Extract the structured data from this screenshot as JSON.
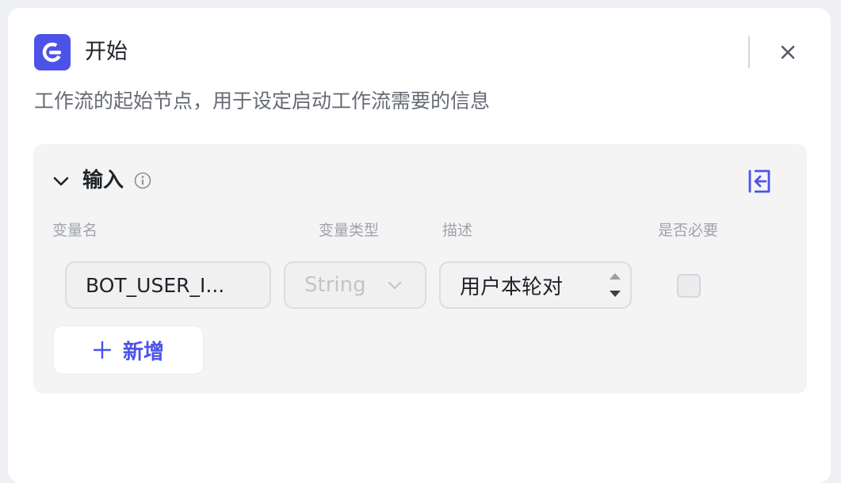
{
  "header": {
    "title": "开始",
    "description": "工作流的起始节点，用于设定启动工作流需要的信息"
  },
  "input_section": {
    "title": "输入",
    "columns": [
      "变量名",
      "变量类型",
      "描述",
      "是否必要"
    ],
    "rows": [
      {
        "name": "BOT_USER_I...",
        "type": "String",
        "description": "用户本轮对",
        "required": false
      }
    ],
    "add_label": "新增"
  },
  "icons": {
    "logo": "start-node-icon",
    "close": "close-icon",
    "collapse": "chevron-down-icon",
    "info": "info-icon",
    "exit": "exit-icon",
    "type_caret": "chevron-down-icon",
    "add": "plus-icon"
  },
  "colors": {
    "accent": "#4d53e8",
    "section_bg": "#f4f4f5"
  }
}
